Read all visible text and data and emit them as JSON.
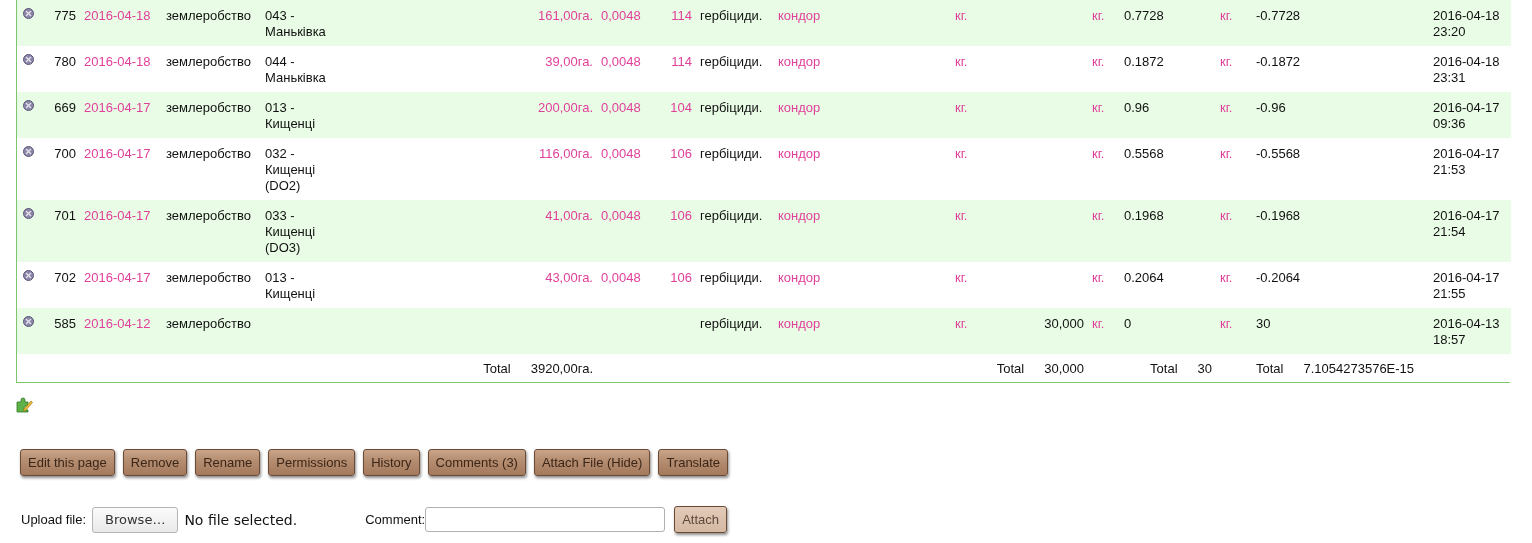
{
  "table": {
    "rows": [
      {
        "id": "775",
        "date": "2016-04-18",
        "category": "землеробство",
        "field": "043 - Маньківка",
        "area": "161,00га.",
        "rate": "0,0048",
        "number": "114",
        "type": "гербіциди.",
        "product": "кондор",
        "unit1": "кг.",
        "unit2": "кг.",
        "value": "0.7728",
        "unit3": "кг.",
        "diff": "-0.7728",
        "datetime": "2016-04-18 23:20"
      },
      {
        "id": "780",
        "date": "2016-04-18",
        "category": "землеробство",
        "field": "044 - Маньківка",
        "area": "39,00га.",
        "rate": "0,0048",
        "number": "114",
        "type": "гербіциди.",
        "product": "кондор",
        "unit1": "кг.",
        "unit2": "кг.",
        "value": "0.1872",
        "unit3": "кг.",
        "diff": "-0.1872",
        "datetime": "2016-04-18 23:31"
      },
      {
        "id": "669",
        "date": "2016-04-17",
        "category": "землеробство",
        "field": "013 - Кищенці",
        "area": "200,00га.",
        "rate": "0,0048",
        "number": "104",
        "type": "гербіциди.",
        "product": "кондор",
        "unit1": "кг.",
        "unit2": "кг.",
        "value": "0.96",
        "unit3": "кг.",
        "diff": "-0.96",
        "datetime": "2016-04-17 09:36"
      },
      {
        "id": "700",
        "date": "2016-04-17",
        "category": "землеробство",
        "field": "032 - Кищенці (DO2)",
        "area": "116,00га.",
        "rate": "0,0048",
        "number": "106",
        "type": "гербіциди.",
        "product": "кондор",
        "unit1": "кг.",
        "unit2": "кг.",
        "value": "0.5568",
        "unit3": "кг.",
        "diff": "-0.5568",
        "datetime": "2016-04-17 21:53"
      },
      {
        "id": "701",
        "date": "2016-04-17",
        "category": "землеробство",
        "field": "033 - Кищенці (DO3)",
        "area": "41,00га.",
        "rate": "0,0048",
        "number": "106",
        "type": "гербіциди.",
        "product": "кондор",
        "unit1": "кг.",
        "unit2": "кг.",
        "value": "0.1968",
        "unit3": "кг.",
        "diff": "-0.1968",
        "datetime": "2016-04-17 21:54"
      },
      {
        "id": "702",
        "date": "2016-04-17",
        "category": "землеробство",
        "field": "013 - Кищенці",
        "area": "43,00га.",
        "rate": "0,0048",
        "number": "106",
        "type": "гербіциди.",
        "product": "кондор",
        "unit1": "кг.",
        "unit2": "кг.",
        "value": "0.2064",
        "unit3": "кг.",
        "diff": "-0.2064",
        "datetime": "2016-04-17 21:55"
      },
      {
        "id": "585",
        "date": "2016-04-12",
        "category": "землеробство",
        "type": "гербіциди.",
        "product": "кондор",
        "unit1": "кг.",
        "quantity": "30,000",
        "unit2": "кг.",
        "value": "0",
        "unit3": "кг.",
        "diff": "30",
        "datetime": "2016-04-13 18:57"
      }
    ],
    "totals": [
      {
        "label": "Total",
        "value": "3920,00га."
      },
      {
        "label": "Total",
        "value": "30,000"
      },
      {
        "label": "Total",
        "value": "30"
      },
      {
        "label": "Total",
        "value": "7.1054273576E-15"
      }
    ]
  },
  "actions": [
    {
      "label": "Edit this page"
    },
    {
      "label": "Remove"
    },
    {
      "label": "Rename"
    },
    {
      "label": "Permissions"
    },
    {
      "label": "History"
    },
    {
      "label": "Comments (3)"
    },
    {
      "label": "Attach File (Hide)"
    },
    {
      "label": "Translate"
    }
  ],
  "upload": {
    "label": "Upload file:",
    "browse": "Browse…",
    "status": "No file selected.",
    "comment_label": "Comment:",
    "attach": {
      "label": "Attach",
      "disabled": true
    }
  }
}
